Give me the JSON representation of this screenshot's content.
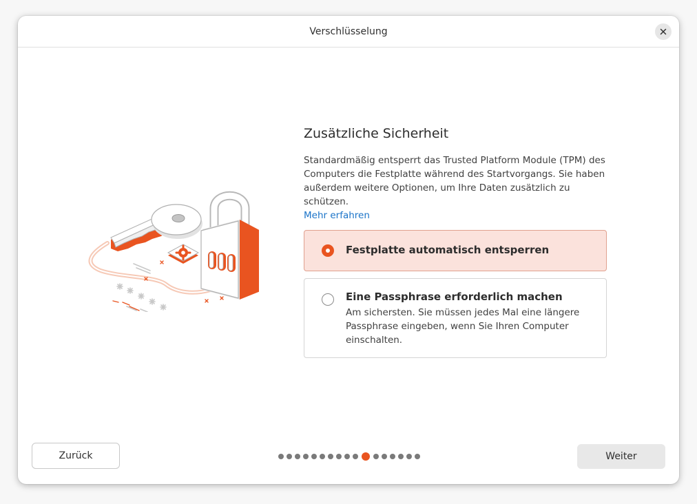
{
  "window": {
    "title": "Verschlüsselung"
  },
  "main": {
    "heading": "Zusätzliche Sicherheit",
    "description": "Standardmäßig entsperrt das Trusted Platform Module (TPM) des Computers die Festplatte während des Startvorgangs. Sie haben außerdem weitere Optionen, um Ihre Daten zusätzlich zu schützen.",
    "learn_more": "Mehr erfahren"
  },
  "options": [
    {
      "title": "Festplatte automatisch entsperren",
      "description": "",
      "selected": true
    },
    {
      "title": "Eine Passphrase erforderlich machen",
      "description": "Am sichersten. Sie müssen jedes Mal eine längere Passphrase eingeben, wenn Sie Ihren Computer einschalten.",
      "selected": false
    }
  ],
  "footer": {
    "back_label": "Zurück",
    "next_label": "Weiter",
    "steps_total": 17,
    "current_step": 11
  },
  "icons": {
    "close": "close-icon",
    "illustration": "key-and-padlock-illustration"
  },
  "colors": {
    "accent": "#e95420",
    "selected_background": "#fbe2dc",
    "link": "#1a73c8"
  }
}
